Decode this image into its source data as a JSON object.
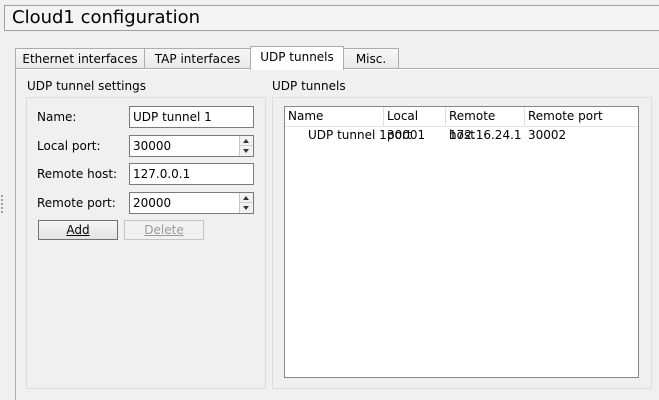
{
  "window": {
    "title": "Cloud1  configuration"
  },
  "tabs": [
    {
      "label": "Ethernet interfaces",
      "active": false
    },
    {
      "label": "TAP interfaces",
      "active": false
    },
    {
      "label": "UDP tunnels",
      "active": true
    },
    {
      "label": "Misc.",
      "active": false
    }
  ],
  "settings": {
    "group_title": "UDP tunnel settings",
    "name_label": "Name:",
    "name_value": "UDP tunnel 1",
    "local_port_label": "Local port:",
    "local_port_value": "30000",
    "remote_host_label": "Remote host:",
    "remote_host_value": "127.0.0.1",
    "remote_port_label": "Remote port:",
    "remote_port_value": "20000",
    "add_button_label": "Add",
    "delete_button_label": "Delete"
  },
  "tunnels": {
    "group_title": "UDP tunnels",
    "columns": [
      "Name",
      "Local port",
      "Remote host",
      "Remote port"
    ],
    "rows": [
      [
        "UDP tunnel 1",
        "30001",
        "172.16.24.1",
        "30002"
      ]
    ]
  }
}
